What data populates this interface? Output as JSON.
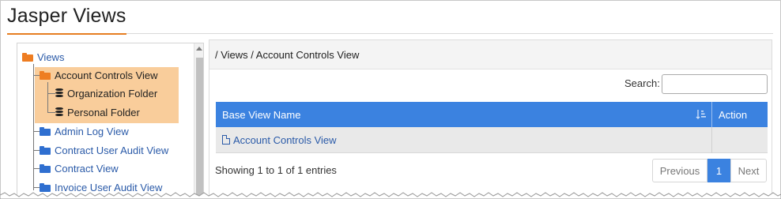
{
  "page": {
    "title": "Jasper Views"
  },
  "tree": {
    "root": {
      "label": "Views",
      "icon": "folder-open-icon"
    },
    "nodes": [
      {
        "label": "Account Controls View",
        "icon": "folder-open-icon",
        "selected": true
      },
      {
        "label": "Organization Folder",
        "icon": "database-icon"
      },
      {
        "label": "Personal Folder",
        "icon": "database-icon"
      },
      {
        "label": "Admin Log View",
        "icon": "folder-icon"
      },
      {
        "label": "Contract User Audit View",
        "icon": "folder-icon"
      },
      {
        "label": "Contract View",
        "icon": "folder-icon"
      },
      {
        "label": "Invoice User Audit View",
        "icon": "folder-icon"
      }
    ]
  },
  "content": {
    "breadcrumb": "/ Views / Account Controls View",
    "search": {
      "label": "Search:",
      "value": "",
      "placeholder": ""
    },
    "table": {
      "headers": [
        "Base View Name",
        "Action"
      ],
      "rows": [
        {
          "name": "Account Controls View",
          "action": ""
        }
      ]
    },
    "info": "Showing 1 to 1 of 1 entries",
    "pagination": {
      "previous": "Previous",
      "current": "1",
      "next": "Next"
    }
  },
  "colors": {
    "accent": "#e67e22",
    "header_blue": "#3b82e0",
    "selection": "#f9cd9b",
    "link": "#2a5aa8"
  }
}
